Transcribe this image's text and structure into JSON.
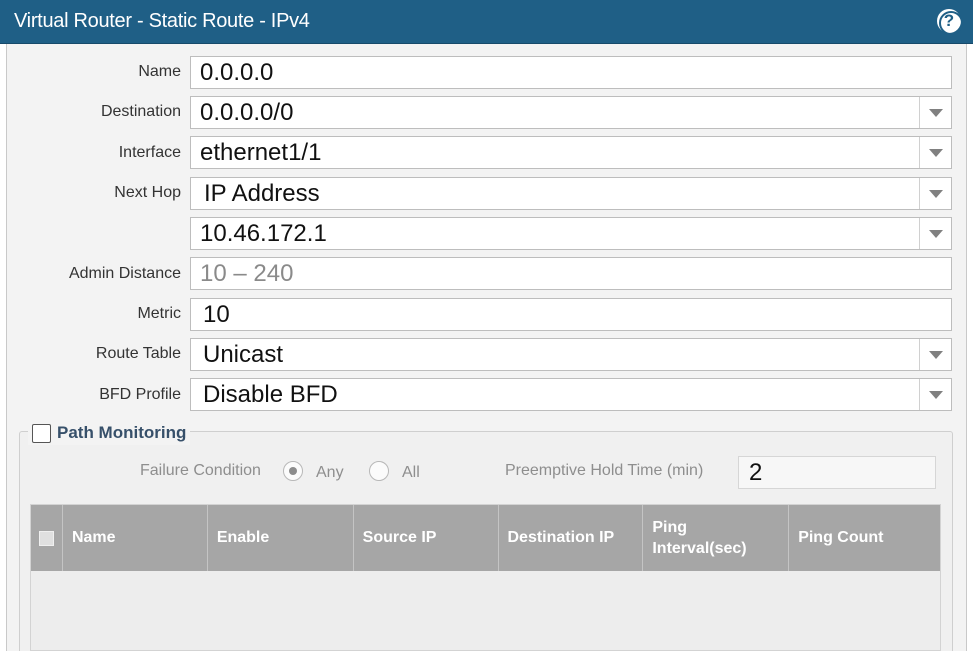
{
  "window": {
    "title": "Virtual Router - Static Route - IPv4",
    "help_icon": "help-icon"
  },
  "form": {
    "name_label": "Name",
    "name_value": "0.0.0.0",
    "destination_label": "Destination",
    "destination_value": "0.0.0.0/0",
    "interface_label": "Interface",
    "interface_value": "ethernet1/1",
    "next_hop_label": "Next Hop",
    "next_hop_type": "IP Address",
    "next_hop_value": "10.46.172.1",
    "admin_distance_label": "Admin Distance",
    "admin_distance_placeholder": "10 – 240",
    "metric_label": "Metric",
    "metric_value": "10",
    "route_table_label": "Route Table",
    "route_table_value": "Unicast",
    "bfd_profile_label": "BFD Profile",
    "bfd_profile_value": "Disable BFD"
  },
  "path_monitoring": {
    "label": "Path Monitoring",
    "checked": false,
    "failure_condition_label": "Failure Condition",
    "options": [
      "Any",
      "All"
    ],
    "selected_option": "Any",
    "preemptive_hold_label": "Preemptive Hold Time (min)",
    "preemptive_hold_value": "2",
    "columns": [
      "Name",
      "Enable",
      "Source IP",
      "Destination IP",
      "Ping Interval(sec)",
      "Ping Count"
    ],
    "rows": []
  },
  "colors": {
    "titlebar": "#1f5f86",
    "grid_header": "#a6a6a6"
  }
}
